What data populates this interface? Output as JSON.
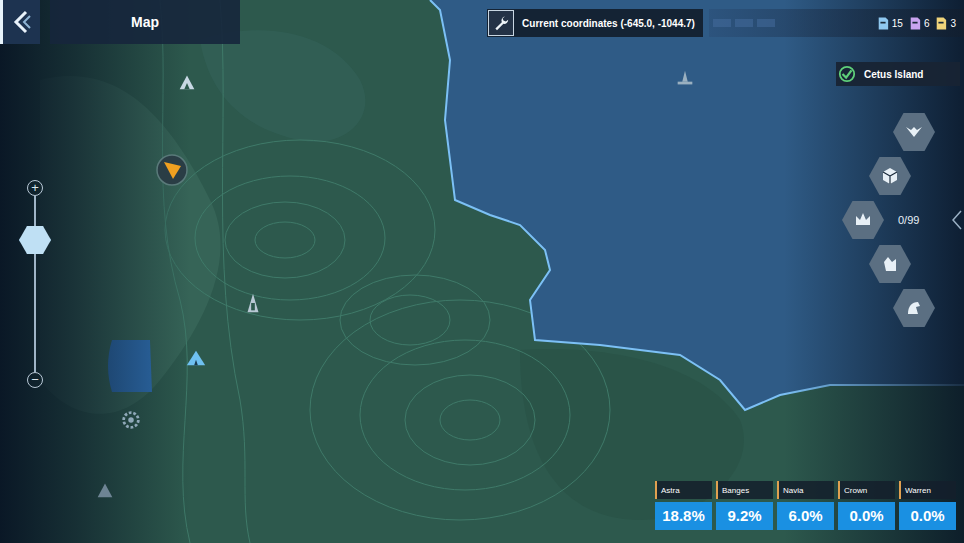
{
  "title": "Map",
  "coordinates": "Current coordinates (-645.0, -1044.7)",
  "resources": [
    {
      "count": "15",
      "color": "#8fc8f0"
    },
    {
      "count": "6",
      "color": "#c9a4f0"
    },
    {
      "count": "3",
      "color": "#f0d47a"
    }
  ],
  "region": {
    "name": "Cetus Island",
    "checked": true
  },
  "collected": "0/99",
  "zoom": {
    "plus": "+",
    "minus": "−",
    "level": 0.75
  },
  "characters": [
    {
      "name": "Astra",
      "percent": "18.8%"
    },
    {
      "name": "Banges",
      "percent": "9.2%"
    },
    {
      "name": "Navia",
      "percent": "6.0%"
    },
    {
      "name": "Crown",
      "percent": "0.0%"
    },
    {
      "name": "Warren",
      "percent": "0.0%"
    }
  ]
}
